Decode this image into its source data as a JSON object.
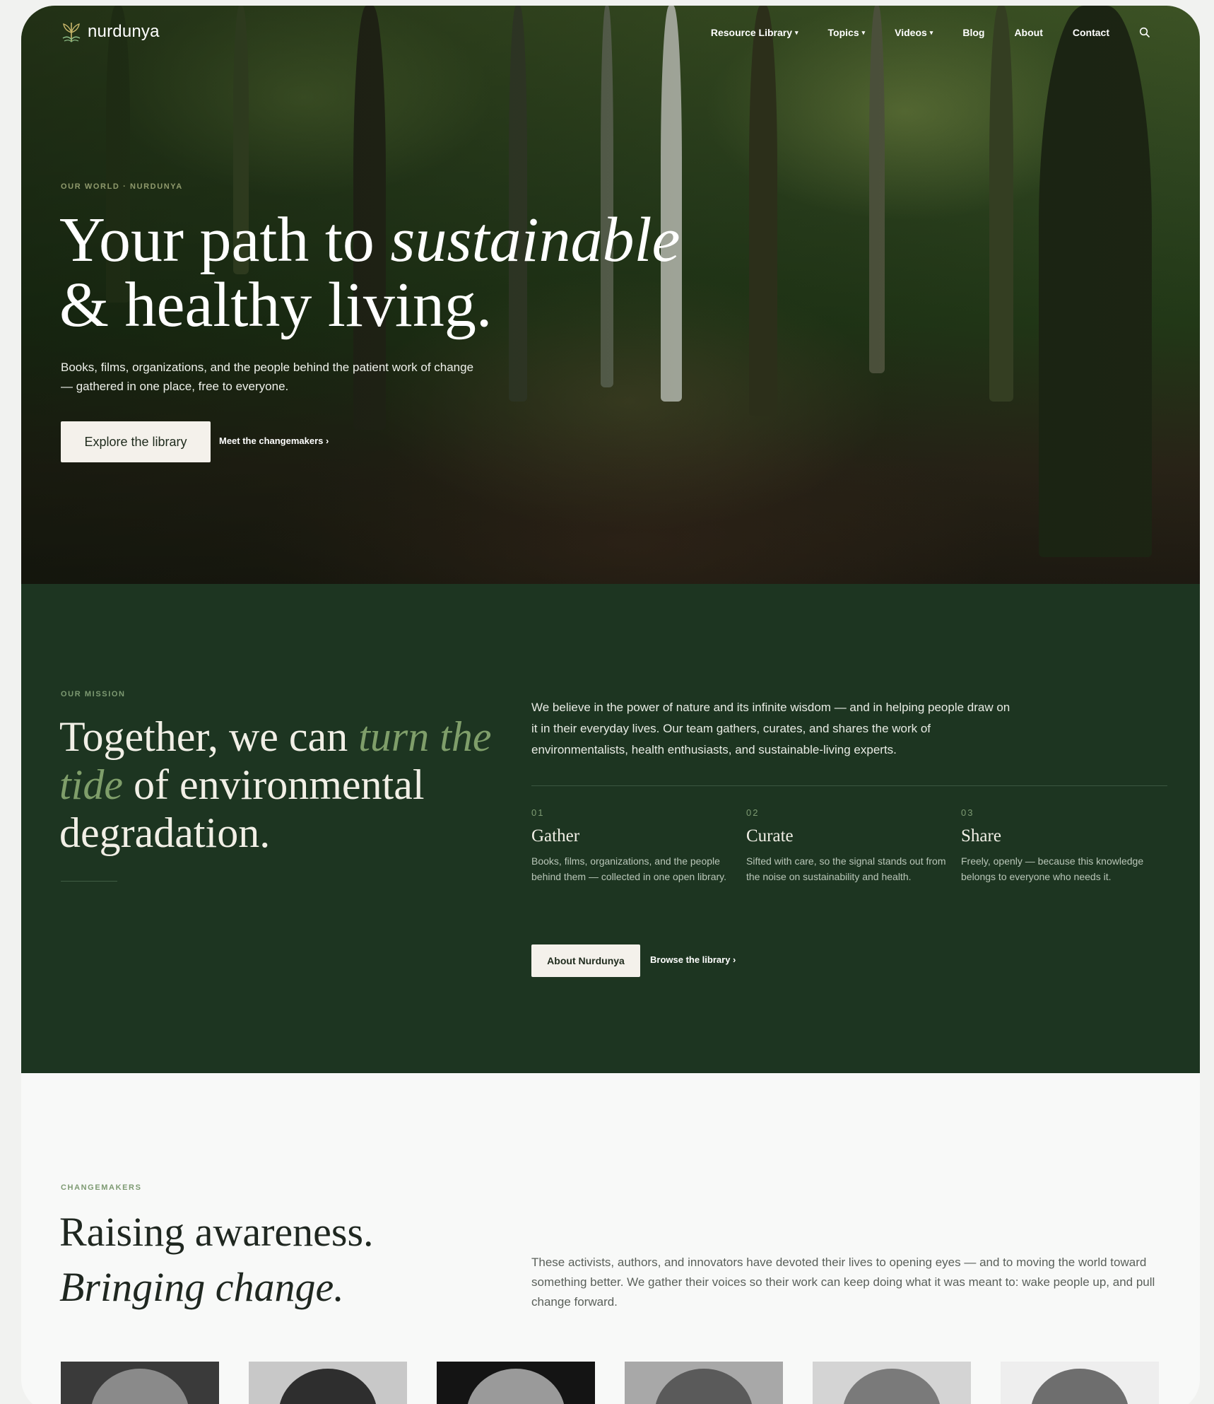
{
  "nav": {
    "brand": "nurdunya",
    "links": [
      {
        "label": "Resource Library",
        "dropdown": true
      },
      {
        "label": "Topics",
        "dropdown": true
      },
      {
        "label": "Videos",
        "dropdown": true
      },
      {
        "label": "Blog",
        "dropdown": false
      },
      {
        "label": "About",
        "dropdown": false
      },
      {
        "label": "Contact",
        "dropdown": false
      }
    ],
    "caret": "▾",
    "search_icon": "search-icon"
  },
  "hero": {
    "eyebrow": "OUR WORLD · NURDUNYA",
    "title_line1": "Your path to ",
    "title_italic": "sustainable",
    "title_line2": "& healthy living.",
    "subtitle": "Books, films, organizations, and the people behind the patient work of change — gathered in one place, free to everyone.",
    "cta_primary": "Explore the library",
    "cta_secondary": "Meet the changemakers ›"
  },
  "mission": {
    "eyebrow": "OUR MISSION",
    "title_start": "Together, we can ",
    "title_italic": "turn the tide",
    "title_end": " of environmental degradation.",
    "intro": "We believe in the power of nature and its infinite wisdom — and in helping people draw on it in their everyday lives. Our team gathers, curates, and shares the work of environmentalists, health enthusiasts, and sustainable-living experts.",
    "steps": [
      {
        "num": "01",
        "title": "Gather",
        "text": "Books, films, organizations, and the people behind them — collected in one open library."
      },
      {
        "num": "02",
        "title": "Curate",
        "text": "Sifted with care, so the signal stands out from the noise on sustainability and health."
      },
      {
        "num": "03",
        "title": "Share",
        "text": "Freely, openly — because this knowledge belongs to everyone who needs it."
      }
    ],
    "cta_primary": "About Nurdunya",
    "cta_secondary": "Browse the library ›"
  },
  "changemakers": {
    "eyebrow": "CHANGEMAKERS",
    "title_line1": "Raising awareness.",
    "title_line2": "Bringing change.",
    "intro": "These activists, authors, and innovators have devoted their lives to opening eyes — and to moving the world toward something better. We gather their voices so their work can keep doing what it was meant to: wake people up, and pull change forward."
  },
  "colors": {
    "mission_bg": "#1d3521",
    "accent_green": "#7f9e6a",
    "button_light": "#f4f1eb",
    "page_bg": "#f8f9f8"
  }
}
